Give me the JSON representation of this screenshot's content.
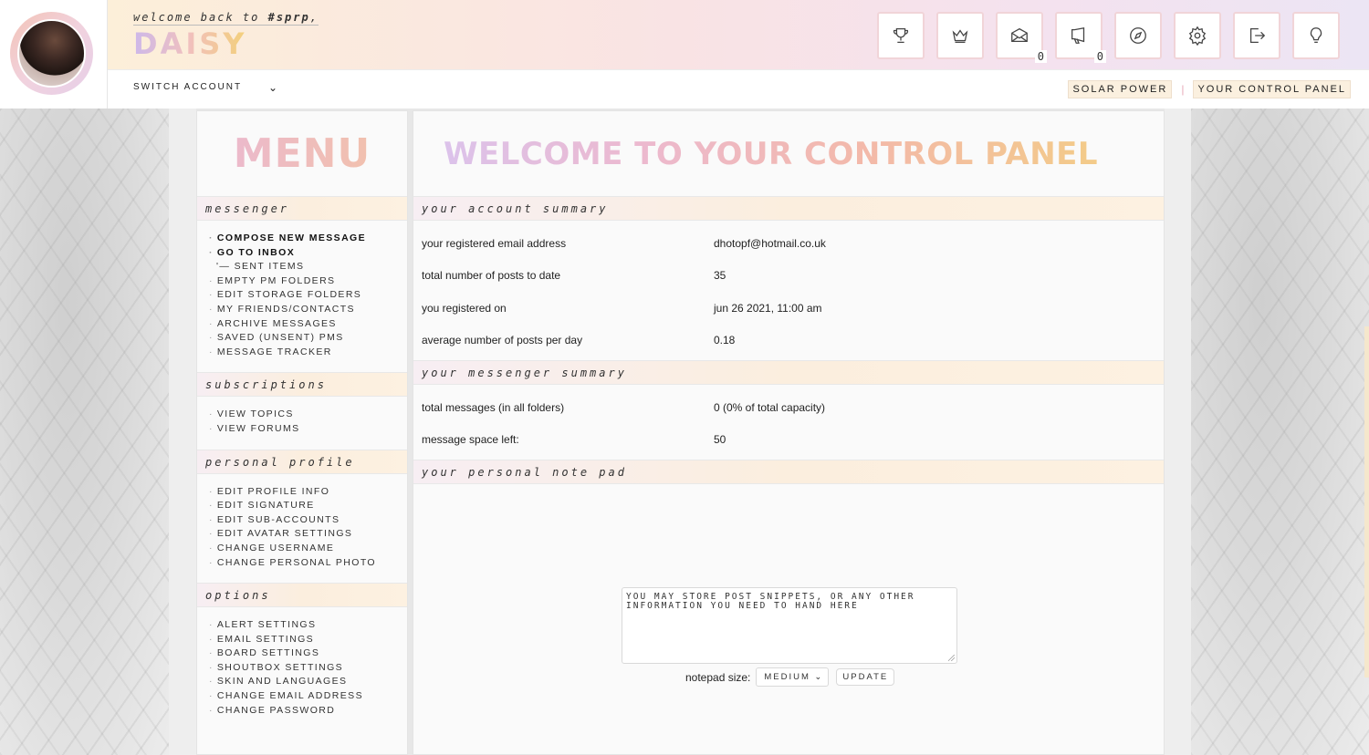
{
  "header": {
    "welcome_prefix": "welcome back to ",
    "forum_tag": "#sprp",
    "welcome_suffix": ",",
    "username": "DAISY",
    "icons": [
      {
        "name": "trophy-icon",
        "badge": ""
      },
      {
        "name": "crown-icon",
        "badge": ""
      },
      {
        "name": "envelope-icon",
        "badge": "0"
      },
      {
        "name": "megaphone-icon",
        "badge": "0"
      },
      {
        "name": "compass-icon",
        "badge": ""
      },
      {
        "name": "gear-icon",
        "badge": ""
      },
      {
        "name": "logout-icon",
        "badge": ""
      },
      {
        "name": "lightbulb-icon",
        "badge": ""
      }
    ],
    "switch_account": "SWITCH ACCOUNT",
    "breadcrumb": {
      "first": "SOLAR POWER",
      "separator": "|",
      "second": "YOUR CONTROL PANEL"
    }
  },
  "sidebar": {
    "title": "MENU",
    "sections": [
      {
        "heading": "messenger",
        "items": [
          "COMPOSE NEW MESSAGE",
          "GO TO INBOX",
          "'— SENT ITEMS",
          "EMPTY PM FOLDERS",
          "EDIT STORAGE FOLDERS",
          "MY FRIENDS/CONTACTS",
          "ARCHIVE MESSAGES",
          "SAVED (UNSENT) PMS",
          "MESSAGE TRACKER"
        ]
      },
      {
        "heading": "subscriptions",
        "items": [
          "VIEW TOPICS",
          "VIEW FORUMS"
        ]
      },
      {
        "heading": "personal profile",
        "items": [
          "EDIT PROFILE INFO",
          "EDIT SIGNATURE",
          "EDIT SUB-ACCOUNTS",
          "EDIT AVATAR SETTINGS",
          "CHANGE USERNAME",
          "CHANGE PERSONAL PHOTO"
        ]
      },
      {
        "heading": "options",
        "items": [
          "ALERT SETTINGS",
          "EMAIL SETTINGS",
          "BOARD SETTINGS",
          "SHOUTBOX SETTINGS",
          "SKIN AND LANGUAGES",
          "CHANGE EMAIL ADDRESS",
          "CHANGE PASSWORD"
        ]
      }
    ]
  },
  "main": {
    "title": "WELCOME TO YOUR CONTROL PANEL",
    "account_summary": {
      "heading": "your account summary",
      "rows": [
        {
          "label": "your registered email address",
          "value": "dhotopf@hotmail.co.uk"
        },
        {
          "label": "total number of posts to date",
          "value": "35"
        },
        {
          "label": "you registered on",
          "value": "jun 26 2021, 11:00 am"
        },
        {
          "label": "average number of posts per day",
          "value": "0.18"
        }
      ]
    },
    "messenger_summary": {
      "heading": "your messenger summary",
      "rows": [
        {
          "label": "total messages (in all folders)",
          "value": "0 (0% of total capacity)"
        },
        {
          "label": "message space left:",
          "value": "50"
        }
      ]
    },
    "notepad": {
      "heading": "your personal note pad",
      "content": "YOU MAY STORE POST SNIPPETS, OR ANY OTHER INFORMATION YOU NEED TO HAND HERE",
      "size_label": "notepad size:",
      "size_value": "MEDIUM",
      "update_button": "UPDATE"
    }
  }
}
